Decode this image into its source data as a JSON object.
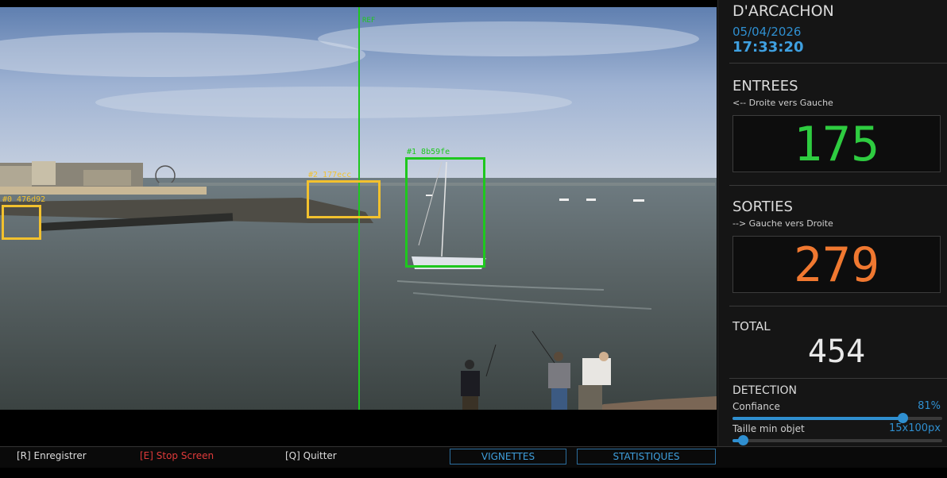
{
  "video": {
    "ref_label": "REF",
    "detections": [
      {
        "label": "#0 476d92",
        "color": "#f2c12e"
      },
      {
        "label": "#2 177ecc",
        "color": "#f2c12e"
      },
      {
        "label": "#1 8b59fe",
        "color": "#1ec81e"
      }
    ]
  },
  "panel": {
    "location": "D'ARCACHON",
    "date": "05/04/2026",
    "time": "17:33:20",
    "entrees": {
      "title": "ENTREES",
      "direction": "<-- Droite vers Gauche",
      "count": "175",
      "color": "#2ecc40"
    },
    "sorties": {
      "title": "SORTIES",
      "direction": "--> Gauche vers Droite",
      "count": "279",
      "color": "#f07830"
    },
    "total": {
      "title": "TOTAL",
      "count": "454"
    },
    "detection": {
      "title": "DETECTION",
      "confidence_label": "Confiance",
      "confidence_value": "81%",
      "confidence_level": 0.81,
      "minsize_label": "Taille min objet",
      "minsize_value": "15x100px",
      "minsize_level": 0.05
    }
  },
  "bottombar": {
    "record": "[R] Enregistrer",
    "stop": "[E] Stop Screen",
    "quit": "[Q] Quitter",
    "vignettes": "VIGNETTES",
    "statistiques": "STATISTIQUES"
  },
  "colors": {
    "accent_blue": "#2f8fd0",
    "stop_red": "#e03a3a"
  }
}
